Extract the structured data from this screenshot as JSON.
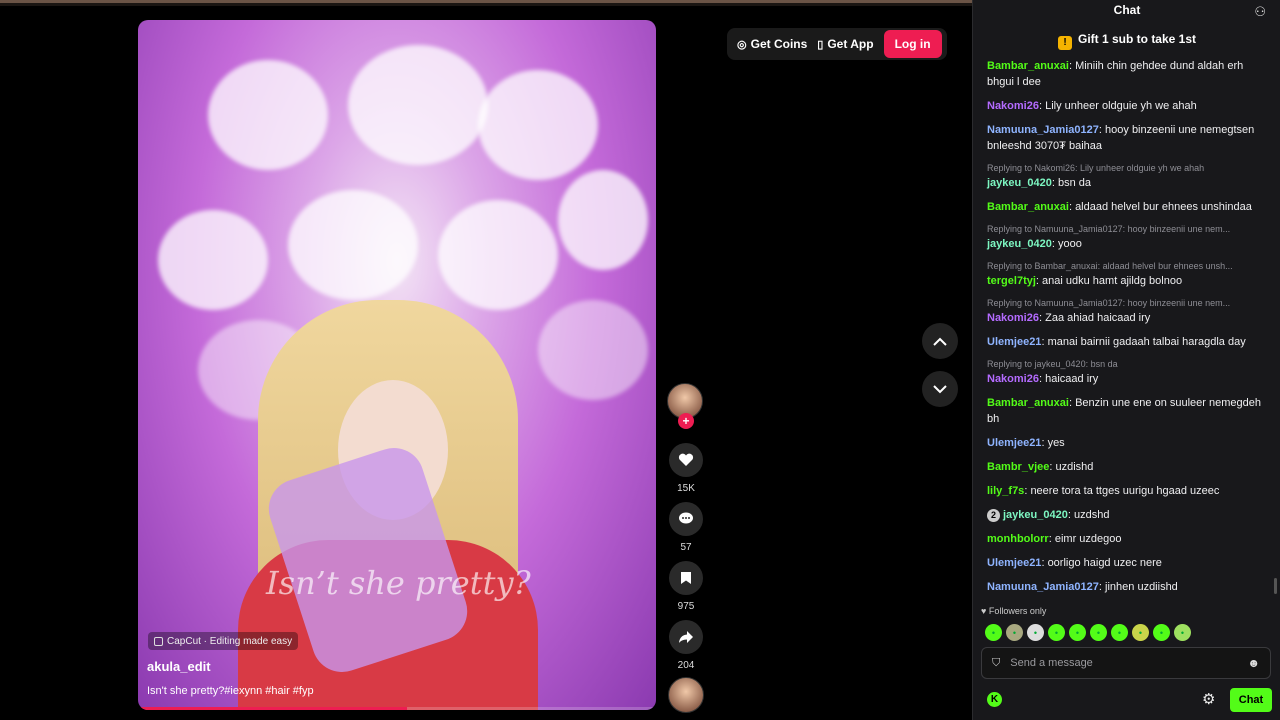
{
  "header": {
    "get_coins": "Get Coins",
    "get_app": "Get App",
    "login": "Log in"
  },
  "video": {
    "overlay_caption": "Isn’t she pretty?",
    "capcut": "CapCut · Editing made easy",
    "author": "akula_edit",
    "description": "Isn't she pretty?#iexynn #hair #fyp",
    "progress_percent": 52,
    "likes": "15K",
    "comments": "57",
    "saves": "975",
    "shares": "204"
  },
  "chat": {
    "title": "Chat",
    "gift_banner": "Gift 1 sub to take 1st",
    "followers_only": "Followers only",
    "placeholder": "Send a message",
    "send_label": "Chat",
    "colors": {
      "green": "#53fc18",
      "purple": "#b46bff",
      "blue": "#8fb4ff",
      "mint": "#7df7c2"
    },
    "messages": [
      {
        "user": "Bambar_anuxai",
        "color": "#53fc18",
        "text": "Miniih chin gehdee dund aldah erh bhgui l dee"
      },
      {
        "user": "Nakomi26",
        "color": "#b46bff",
        "text": "Lily unheer oldguie yh we ahah"
      },
      {
        "user": "Namuuna_Jamia0127",
        "color": "#8fb4ff",
        "text": "hooy binzeenii une nemegtsen bnleeshd 3070₮ baihaa"
      },
      {
        "reply": "Replying to Nakomi26: Lily unheer oldguie yh we ahah",
        "user": "jaykeu_0420",
        "color": "#7df7c2",
        "text": "bsn da"
      },
      {
        "user": "Bambar_anuxai",
        "color": "#53fc18",
        "text": "aldaad helvel bur ehnees unshindaa"
      },
      {
        "reply": "Replying to Namuuna_Jamia0127: hooy binzeenii une nem...",
        "user": "jaykeu_0420",
        "color": "#7df7c2",
        "text": "yooo"
      },
      {
        "reply": "Replying to Bambar_anuxai: aldaad helvel bur ehnees unsh...",
        "user": "tergel7tyj",
        "color": "#53fc18",
        "text": "anai udku hamt ajildg bolnoo"
      },
      {
        "reply": "Replying to Namuuna_Jamia0127: hooy binzeenii une nem...",
        "user": "Nakomi26",
        "color": "#b46bff",
        "text": "Zaa ahiad haicaad iry"
      },
      {
        "user": "Ulemjee21",
        "color": "#8fb4ff",
        "text": "manai bairnii gadaah talbai haragdla day"
      },
      {
        "reply": "Replying to jaykeu_0420: bsn da",
        "user": "Nakomi26",
        "color": "#b46bff",
        "text": "haicaad iry"
      },
      {
        "user": "Bambar_anuxai",
        "color": "#53fc18",
        "text": "Benzin une ene on suuleer nemegdeh bh"
      },
      {
        "user": "Ulemjee21",
        "color": "#8fb4ff",
        "text": "yes"
      },
      {
        "user": "Bambr_vjee",
        "color": "#53fc18",
        "text": "uzdishd"
      },
      {
        "user": "lily_f7s",
        "color": "#53fc18",
        "text": "neere tora ta ttges uurigu hgaad uzeec"
      },
      {
        "badge": "2",
        "user": "jaykeu_0420",
        "color": "#7df7c2",
        "text": "uzdshd"
      },
      {
        "user": "monhbolorr",
        "color": "#53fc18",
        "text": "eimr uzdegoo"
      },
      {
        "user": "Ulemjee21",
        "color": "#8fb4ff",
        "text": "oorligo haigd uzec nere"
      },
      {
        "user": "Namuuna_Jamia0127",
        "color": "#8fb4ff",
        "text": "jinhen uzdiishd"
      }
    ]
  }
}
